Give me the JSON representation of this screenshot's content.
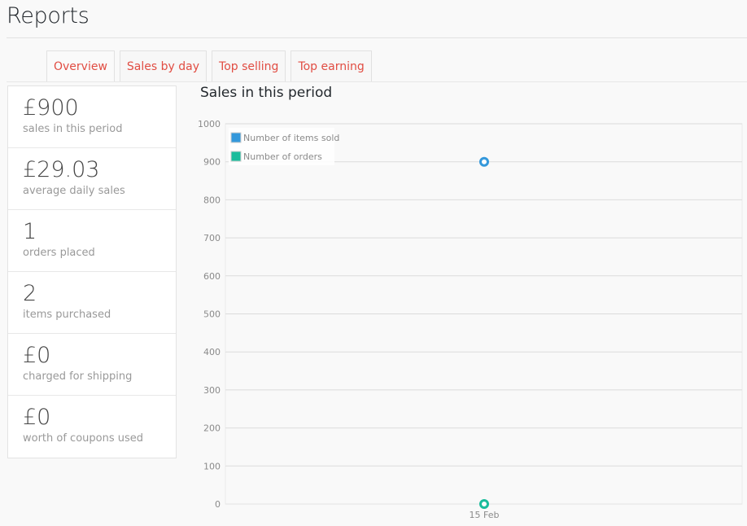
{
  "page": {
    "title": "Reports"
  },
  "tabs": [
    {
      "label": "Overview",
      "active": true
    },
    {
      "label": "Sales by day",
      "active": false
    },
    {
      "label": "Top selling",
      "active": false
    },
    {
      "label": "Top earning",
      "active": false
    }
  ],
  "stats": [
    {
      "value": "£900",
      "label": "sales in this period"
    },
    {
      "value": "£29.03",
      "label": "average daily sales"
    },
    {
      "value": "1",
      "label": "orders placed"
    },
    {
      "value": "2",
      "label": "items purchased"
    },
    {
      "value": "£0",
      "label": "charged for shipping"
    },
    {
      "value": "£0",
      "label": "worth of coupons used"
    }
  ],
  "chart": {
    "title": "Sales in this period"
  },
  "chart_data": {
    "type": "scatter",
    "x": [
      "15 Feb"
    ],
    "series": [
      {
        "name": "Number of items sold",
        "values": [
          900
        ],
        "color": "#3498db"
      },
      {
        "name": "Number of orders",
        "values": [
          0
        ],
        "color": "#1abc9c"
      }
    ],
    "ylim": [
      0,
      1000
    ],
    "yticks": [
      0,
      100,
      200,
      300,
      400,
      500,
      600,
      700,
      800,
      900,
      1000
    ],
    "grid": true,
    "legend": "top-left"
  },
  "colors": {
    "accent": "#e14d43",
    "series_blue": "#3498db",
    "series_teal": "#1abc9c"
  }
}
